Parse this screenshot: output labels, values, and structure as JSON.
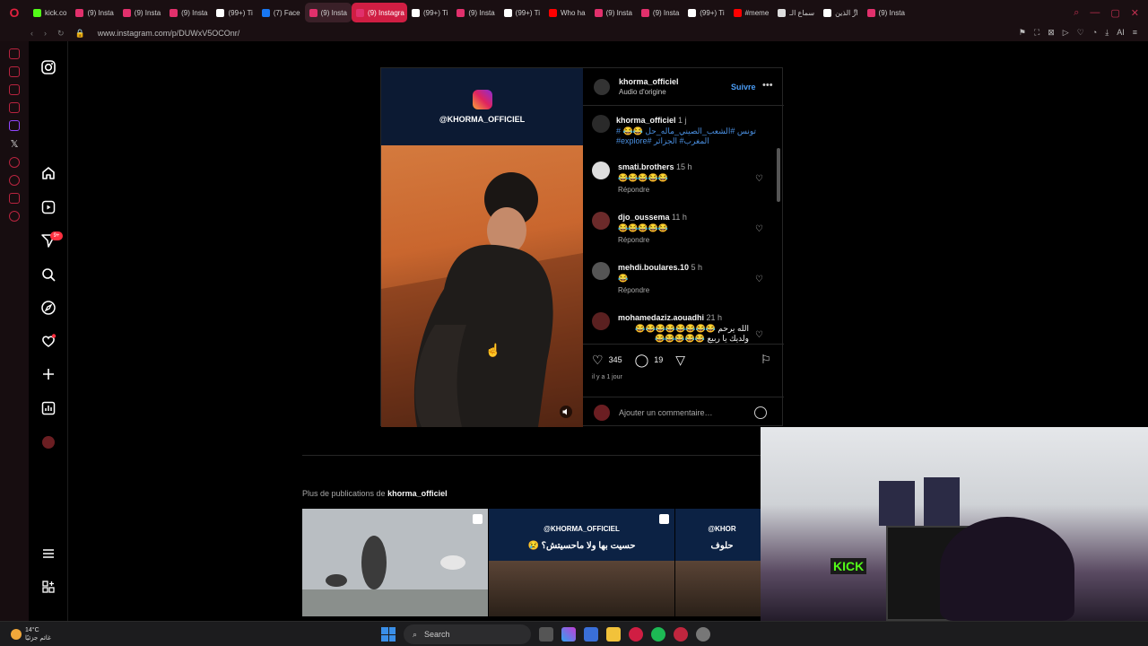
{
  "browser": {
    "tabs": [
      {
        "label": "kick.co",
        "color": "#53fc18"
      },
      {
        "label": "(9) Insta",
        "color": "#e1306c"
      },
      {
        "label": "(9) Insta",
        "color": "#e1306c"
      },
      {
        "label": "(9) Insta",
        "color": "#e1306c"
      },
      {
        "label": "(99+) Ti",
        "color": "#ffffff"
      },
      {
        "label": "(7) Face",
        "color": "#1877f2"
      },
      {
        "label": "(9) Insta",
        "color": "#e1306c"
      },
      {
        "label": "(9) Instagra",
        "color": "#e1306c"
      },
      {
        "label": "(99+) Ti",
        "color": "#ffffff"
      },
      {
        "label": "(9) Insta",
        "color": "#e1306c"
      },
      {
        "label": "(99+) Ti",
        "color": "#ffffff"
      },
      {
        "label": "Who ha",
        "color": "#ff0000"
      },
      {
        "label": "(9) Insta",
        "color": "#e1306c"
      },
      {
        "label": "(9) Insta",
        "color": "#e1306c"
      },
      {
        "label": "(99+) Ti",
        "color": "#ffffff"
      },
      {
        "label": "#meme",
        "color": "#ff0000"
      },
      {
        "label": "سماع الـ",
        "color": "#dddddd"
      },
      {
        "label": "ارٍّ الذين",
        "color": "#ffffff"
      },
      {
        "label": "(9) Insta",
        "color": "#e1306c"
      }
    ],
    "active_tab_index": 7,
    "url": "www.instagram.com/p/DUWxV5OCOnr/",
    "ai_label": "AI"
  },
  "post": {
    "media": {
      "overlay_handle": "@KHORMA_OFFICIEL"
    },
    "author": {
      "username": "khorma_officiel",
      "audio": "Audio d'origine",
      "follow_label": "Suivre"
    },
    "caption": {
      "username": "khorma_officiel",
      "time": "1 j",
      "text_line1": "تونس #الشعب_الصيني_ماله_حل 😂😂 #",
      "text_line2": "المغرب# الجزائر #explore#"
    },
    "comments": [
      {
        "username": "smati.brothers",
        "time": "15 h",
        "text": "😂😂😂😂😂",
        "reply": "Répondre"
      },
      {
        "username": "djo_oussema",
        "time": "11 h",
        "text": "😂😂😂😂😂",
        "reply": "Répondre"
      },
      {
        "username": "mehdi.boulares.10",
        "time": "5 h",
        "text": "😂",
        "reply": "Répondre"
      },
      {
        "username": "mohamedaziz.aouadhi",
        "time": "21 h",
        "text": "الله يرحم 😂😂😂😂😂😂😂😂",
        "text2": "ولديك يا ربيع 😂😂😂😂😂"
      }
    ],
    "likes": "345",
    "comment_count": "19",
    "date": "il y a 1 jour",
    "add_comment_placeholder": "Ajouter un commentaire…"
  },
  "more": {
    "prefix": "Plus de publications de",
    "username": "khorma_officiel",
    "thumbs": [
      {
        "handle": "",
        "caption": ""
      },
      {
        "handle": "@KHORMA_OFFICIEL",
        "caption": "حسيت بها ولا ماحسيتش؟ 😢"
      },
      {
        "handle": "@KHOR",
        "caption": "حلوف"
      }
    ]
  },
  "stream_overlay": {
    "kick_sign": "KICK"
  },
  "taskbar": {
    "temp": "14°C",
    "weather_text": "غائم جزئيًا",
    "search_label": "Search"
  }
}
